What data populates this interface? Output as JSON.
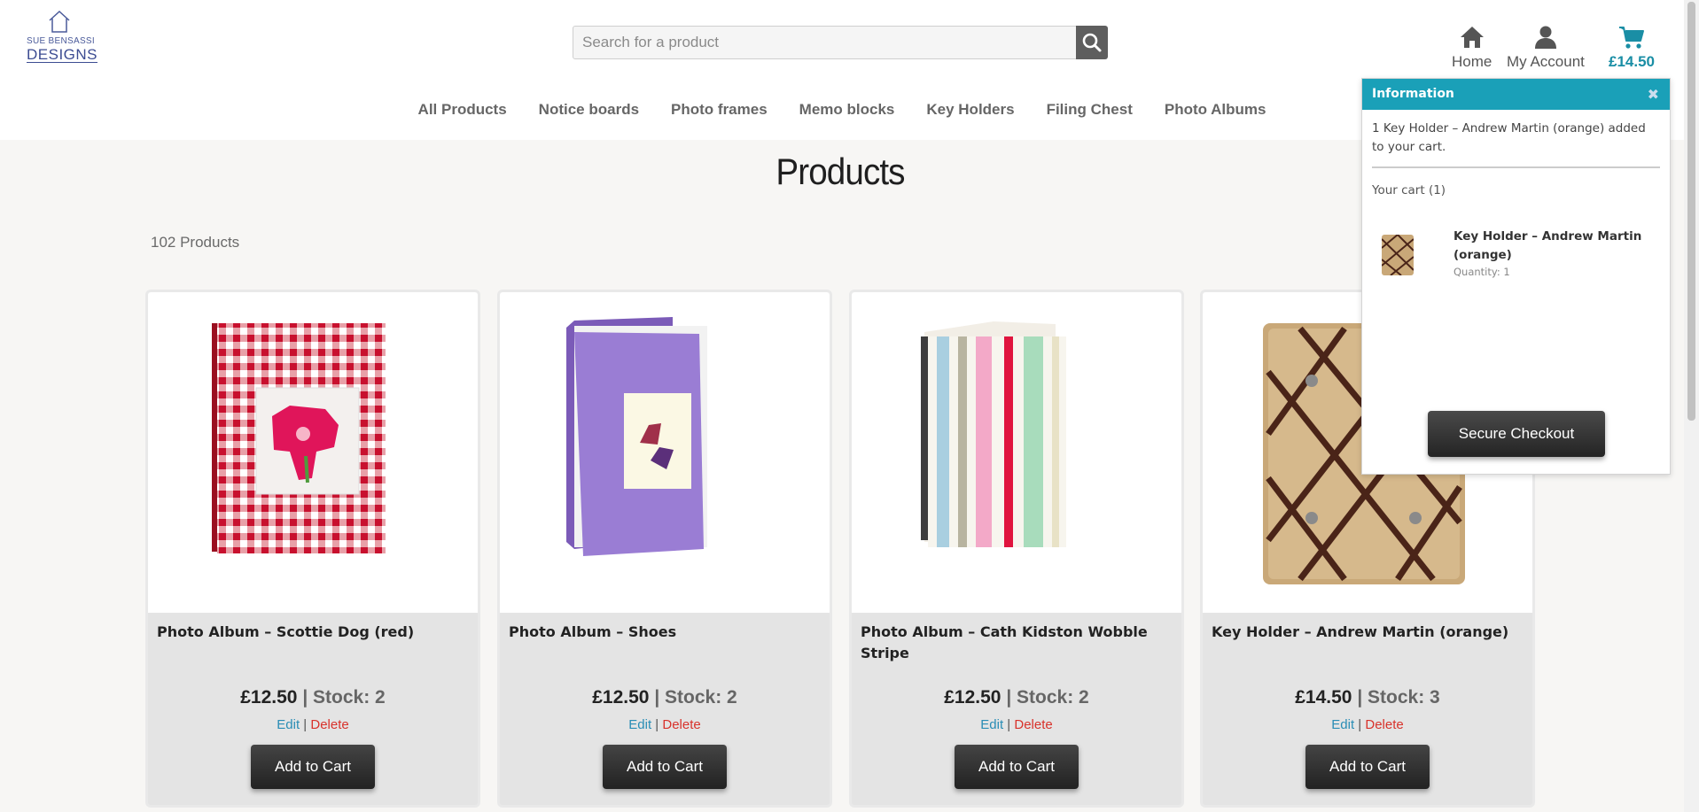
{
  "brand": {
    "line1": "SUE BENSASSI",
    "line2": "DESIGNS"
  },
  "search": {
    "placeholder": "Search for a product",
    "value": ""
  },
  "header_nav": {
    "home": "Home",
    "account": "My Account",
    "cart_total": "£14.50"
  },
  "menu": [
    "All Products",
    "Notice boards",
    "Photo frames",
    "Memo blocks",
    "Key Holders",
    "Filing Chest",
    "Photo Albums"
  ],
  "page": {
    "title": "Products",
    "count": "102 Products"
  },
  "products": [
    {
      "name": "Photo Album – Scottie Dog (red)",
      "price": "£12.50",
      "sep": "|",
      "stock": "Stock: 2",
      "edit": "Edit",
      "delete": "Delete",
      "add": "Add to Cart"
    },
    {
      "name": "Photo Album – Shoes",
      "price": "£12.50",
      "sep": "|",
      "stock": "Stock: 2",
      "edit": "Edit",
      "delete": "Delete",
      "add": "Add to Cart"
    },
    {
      "name": "Photo Album – Cath Kidston Wobble Stripe",
      "price": "£12.50",
      "sep": "|",
      "stock": "Stock: 2",
      "edit": "Edit",
      "delete": "Delete",
      "add": "Add to Cart"
    },
    {
      "name": "Key Holder – Andrew Martin (orange)",
      "price": "£14.50",
      "sep": "|",
      "stock": "Stock: 3",
      "edit": "Edit",
      "delete": "Delete",
      "add": "Add to Cart"
    }
  ],
  "link_sep": "|",
  "popup": {
    "title": "Information",
    "close": "✖",
    "message": "1 Key Holder – Andrew Martin (orange) added to your cart.",
    "cart_label": "Your cart (1)",
    "item_name": "Key Holder – Andrew Martin (orange)",
    "item_qty": "Quantity: 1",
    "checkout": "Secure Checkout"
  },
  "colors": {
    "accent": "#1aa0b8",
    "cart": "#1a8ea5",
    "delete": "#d8322b",
    "edit": "#2a8db5"
  }
}
